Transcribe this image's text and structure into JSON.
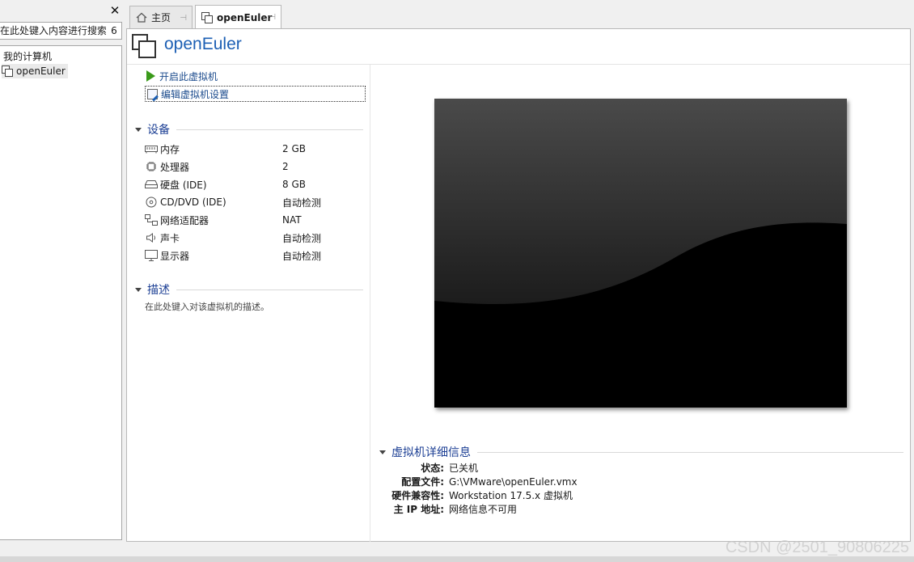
{
  "library": {
    "close_glyph": "✕",
    "search_placeholder": "在此处键入内容进行搜索",
    "search_dropdown": "6",
    "tree_root": "我的计算机",
    "vm_item": "openEuler"
  },
  "tabs": [
    {
      "label": "主页",
      "icon": "home-icon"
    },
    {
      "label": "openEuler",
      "icon": "vm-icon"
    }
  ],
  "vm": {
    "title": "openEuler",
    "actions": {
      "power_on": "开启此虚拟机",
      "edit_settings": "编辑虚拟机设置"
    },
    "devices_title": "设备",
    "devices": [
      {
        "icon": "memory-icon",
        "name": "内存",
        "value": "2 GB"
      },
      {
        "icon": "cpu-icon",
        "name": "处理器",
        "value": "2"
      },
      {
        "icon": "harddisk-icon",
        "name": "硬盘 (IDE)",
        "value": "8 GB"
      },
      {
        "icon": "cdrom-icon",
        "name": "CD/DVD (IDE)",
        "value": "自动检测"
      },
      {
        "icon": "network-icon",
        "name": "网络适配器",
        "value": "NAT"
      },
      {
        "icon": "sound-icon",
        "name": "声卡",
        "value": "自动检测"
      },
      {
        "icon": "display-icon",
        "name": "显示器",
        "value": "自动检测"
      }
    ],
    "desc_title": "描述",
    "desc_placeholder": "在此处键入对该虚拟机的描述。",
    "details_title": "虚拟机详细信息",
    "details": [
      {
        "key": "状态:",
        "value": "已关机"
      },
      {
        "key": "配置文件:",
        "value": "G:\\VMware\\openEuler.vmx"
      },
      {
        "key": "硬件兼容性:",
        "value": "Workstation 17.5.x 虚拟机"
      },
      {
        "key": "主 IP 地址:",
        "value": "网络信息不可用"
      }
    ]
  },
  "watermark": "CSDN @2501_90806225"
}
